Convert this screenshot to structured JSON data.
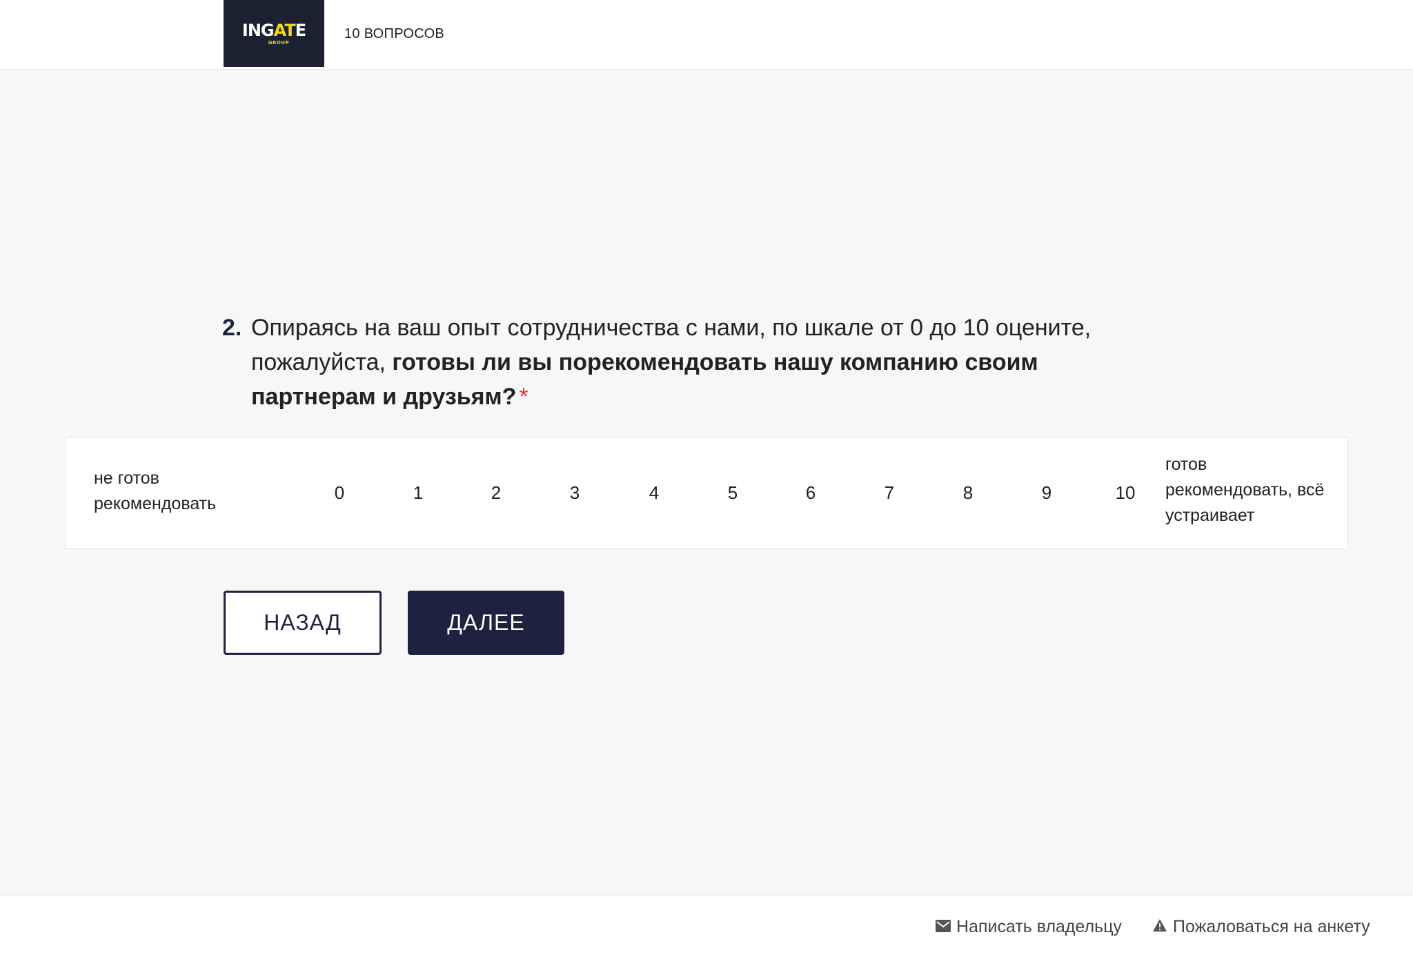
{
  "header": {
    "logo": {
      "text_white_1": "ING",
      "text_yellow": "AT",
      "text_white_2": "E",
      "subtext": "GROUP"
    },
    "question_count": "10 ВОПРОСОВ"
  },
  "question": {
    "number": "2.",
    "text_regular": "Опираясь на ваш опыт сотрудничества с нами, по шкале от 0 до 10 оцените, пожалуйста, ",
    "text_bold": "готовы ли вы порекомендовать нашу компанию своим партнерам и друзьям?",
    "required_mark": "*"
  },
  "scale": {
    "left_label": "не готов рекомендовать",
    "right_label": "готов рекомендовать, всё устраивает",
    "options": [
      "0",
      "1",
      "2",
      "3",
      "4",
      "5",
      "6",
      "7",
      "8",
      "9",
      "10"
    ]
  },
  "buttons": {
    "back": "НАЗАД",
    "next": "ДАЛЕЕ"
  },
  "footer": {
    "contact_owner": "Написать владельцу",
    "report": "Пожаловаться на анкету"
  },
  "colors": {
    "accent": "#1e2140",
    "logo_bg": "#1b2130",
    "logo_yellow": "#f5d90a",
    "required": "#e53935"
  },
  "icons": [
    "envelope-icon",
    "warning-icon"
  ]
}
